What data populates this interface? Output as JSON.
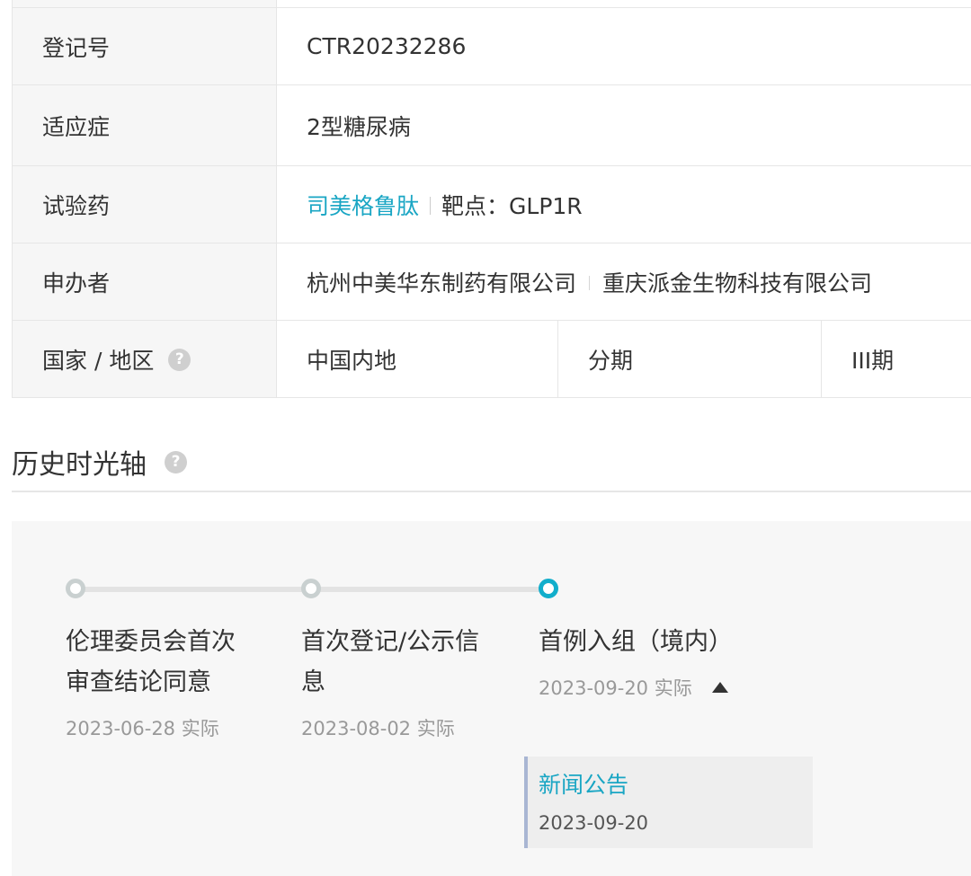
{
  "trial_info": {
    "registration_label": "登记号",
    "registration_value": "CTR20232286",
    "indication_label": "适应症",
    "indication_value": "2型糖尿病",
    "drug_label": "试验药",
    "drug_name": "司美格鲁肽",
    "drug_target": "靶点：GLP1R",
    "sponsor_label": "申办者",
    "sponsors": [
      "杭州中美华东制药有限公司",
      "重庆派金生物科技有限公司"
    ],
    "country_label": "国家 / 地区",
    "country_value": "中国内地",
    "phase_label": "分期",
    "phase_value": "III期",
    "help_glyph": "?"
  },
  "timeline": {
    "title": "历史时光轴",
    "help_glyph": "?",
    "events": [
      {
        "label": "伦理委员会首次审查结论同意",
        "date": "2023-06-28 实际",
        "active": false
      },
      {
        "label": "首次登记/公示信息",
        "date": "2023-08-02 实际",
        "active": false
      },
      {
        "label": "首例入组（境内）",
        "date": "2023-09-20 实际",
        "active": true
      }
    ],
    "expanded_icon": "caret-up-icon",
    "news": {
      "title": "新闻公告",
      "date": "2023-09-20"
    }
  },
  "colors": {
    "accent": "#1aa6c4",
    "active_dot": "#12aecb",
    "label_bg": "#f6f6f6",
    "panel_bg": "#f7f7f7"
  }
}
